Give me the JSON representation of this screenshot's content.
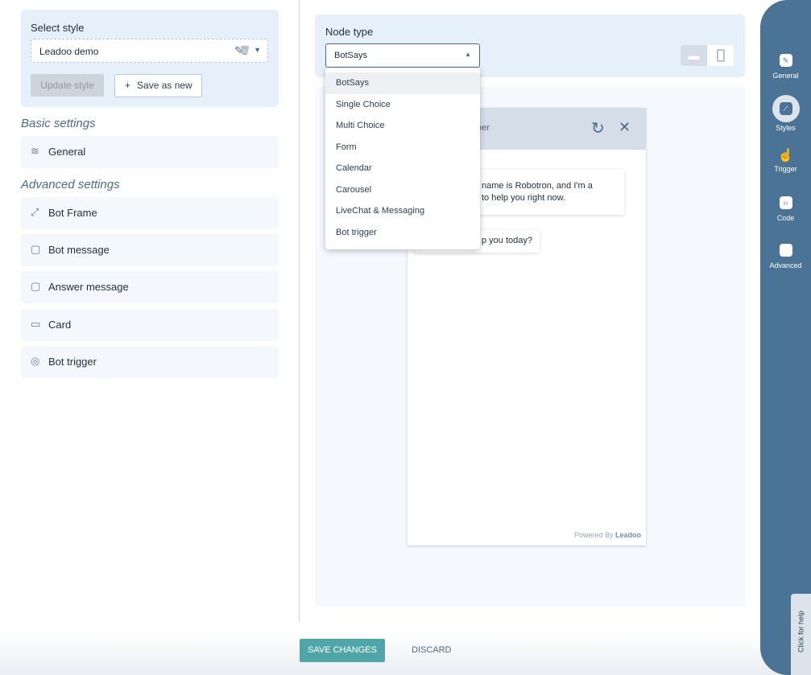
{
  "style_panel": {
    "title": "Select style",
    "selected": "Leadoo demo",
    "update_label": "Update style",
    "save_new_label": "Save as new"
  },
  "basic": {
    "title": "Basic settings",
    "items": [
      {
        "label": "General",
        "icon": "layers-icon"
      }
    ]
  },
  "advanced": {
    "title": "Advanced settings",
    "items": [
      {
        "label": "Bot Frame",
        "icon": "resize-icon"
      },
      {
        "label": "Bot message",
        "icon": "chat-bubble-icon"
      },
      {
        "label": "Answer message",
        "icon": "chat-bubble-icon"
      },
      {
        "label": "Card",
        "icon": "card-icon"
      },
      {
        "label": "Bot trigger",
        "icon": "target-icon"
      }
    ]
  },
  "node": {
    "title": "Node type",
    "selected": "BotSays",
    "options": [
      "BotSays",
      "Single Choice",
      "Multi Choice",
      "Form",
      "Calendar",
      "Carousel",
      "LiveChat & Messaging",
      "Bot trigger"
    ]
  },
  "preview": {
    "header_fragment": "per",
    "msg1_line1": "name is Robotron, and I'm a",
    "msg1_line2": "to help you right now.",
    "msg2": "p you today?",
    "powered": "Powered By",
    "brand": "Leadoo"
  },
  "sidebar": {
    "items": [
      {
        "label": "General",
        "icon": "pencil-icon"
      },
      {
        "label": "Styles",
        "icon": "brush-icon",
        "active": true
      },
      {
        "label": "Trigger",
        "icon": "hand-pointer-icon"
      },
      {
        "label": "Code",
        "icon": "code-icon"
      },
      {
        "label": "Advanced",
        "icon": "app-badge-icon"
      }
    ],
    "help": "Click for help"
  },
  "footer": {
    "save": "SAVE CHANGES",
    "discard": "DISCARD"
  },
  "colors": {
    "accent": "#4ea6a8",
    "sidebar": "#4a7396",
    "panel": "#e6f0fa"
  }
}
